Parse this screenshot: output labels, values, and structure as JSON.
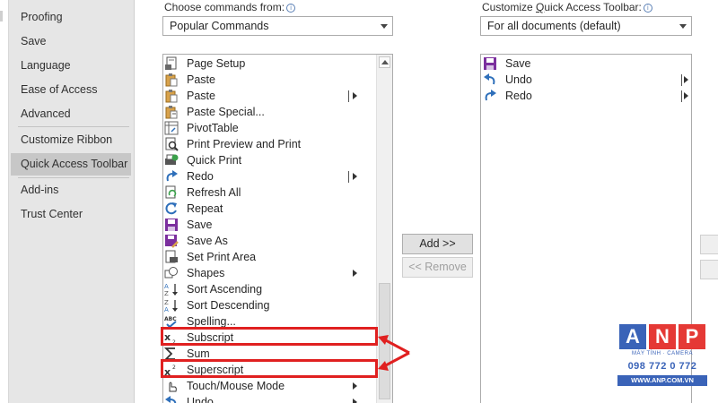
{
  "sidebar": {
    "items": [
      {
        "label": "Proofing",
        "selected": false
      },
      {
        "label": "Save",
        "selected": false
      },
      {
        "label": "Language",
        "selected": false
      },
      {
        "label": "Ease of Access",
        "selected": false
      },
      {
        "label": "Advanced",
        "selected": false
      },
      {
        "label": "Customize Ribbon",
        "selected": false
      },
      {
        "label": "Quick Access Toolbar",
        "selected": true
      },
      {
        "label": "Add-ins",
        "selected": false
      },
      {
        "label": "Trust Center",
        "selected": false
      }
    ]
  },
  "choose_commands": {
    "label_pre": "Choose commands from:",
    "dropdown_value": "Popular Commands"
  },
  "command_list": {
    "items": [
      {
        "label": "Page Setup",
        "icon": "page-setup-icon",
        "submenu": false
      },
      {
        "label": "Paste",
        "icon": "paste-icon",
        "submenu": false
      },
      {
        "label": "Paste",
        "icon": "paste-icon",
        "submenu": true,
        "split": true
      },
      {
        "label": "Paste Special...",
        "icon": "paste-special-icon",
        "submenu": false
      },
      {
        "label": "PivotTable",
        "icon": "pivottable-icon",
        "submenu": false
      },
      {
        "label": "Print Preview and Print",
        "icon": "print-preview-icon",
        "submenu": false
      },
      {
        "label": "Quick Print",
        "icon": "quick-print-icon",
        "submenu": false
      },
      {
        "label": "Redo",
        "icon": "redo-icon",
        "submenu": true,
        "split": true
      },
      {
        "label": "Refresh All",
        "icon": "refresh-all-icon",
        "submenu": false
      },
      {
        "label": "Repeat",
        "icon": "repeat-icon",
        "submenu": false
      },
      {
        "label": "Save",
        "icon": "save-icon",
        "submenu": false
      },
      {
        "label": "Save As",
        "icon": "save-as-icon",
        "submenu": false
      },
      {
        "label": "Set Print Area",
        "icon": "set-print-area-icon",
        "submenu": false
      },
      {
        "label": "Shapes",
        "icon": "shapes-icon",
        "submenu": true,
        "split": false
      },
      {
        "label": "Sort Ascending",
        "icon": "sort-ascending-icon",
        "submenu": false
      },
      {
        "label": "Sort Descending",
        "icon": "sort-descending-icon",
        "submenu": false
      },
      {
        "label": "Spelling...",
        "icon": "spelling-icon",
        "submenu": false
      },
      {
        "label": "Subscript",
        "icon": "subscript-icon",
        "submenu": false
      },
      {
        "label": "Sum",
        "icon": "sum-icon",
        "submenu": false
      },
      {
        "label": "Superscript",
        "icon": "superscript-icon",
        "submenu": false
      },
      {
        "label": "Touch/Mouse Mode",
        "icon": "touch-mode-icon",
        "submenu": true,
        "split": false
      },
      {
        "label": "Undo",
        "icon": "undo-icon",
        "submenu": true,
        "split": false
      }
    ]
  },
  "buttons": {
    "add_label": "Add >>",
    "remove_label": "<< Remove"
  },
  "customize_toolbar": {
    "label_pre": "Customize ",
    "label_accel": "Q",
    "label_post": "uick Access Toolbar:",
    "dropdown_value": "For all documents (default)",
    "items": [
      {
        "label": "Save",
        "icon": "save-icon",
        "submenu": false
      },
      {
        "label": "Undo",
        "icon": "undo-icon",
        "submenu": true
      },
      {
        "label": "Redo",
        "icon": "redo-icon",
        "submenu": true
      }
    ]
  },
  "watermark": {
    "letters": [
      "A",
      "N",
      "P"
    ],
    "tagline": "MÁY TÍNH · CAMERA",
    "phone": "098 772 0 772",
    "website": "WWW.ANP.COM.VN"
  },
  "colors": {
    "highlight": "#e02020",
    "selected_nav": "#c7c7c7",
    "logo_red": "#e53935",
    "logo_blue": "#3a63b8",
    "save_purple": "#7b2f9e",
    "arrow_blue": "#2e6fba"
  }
}
